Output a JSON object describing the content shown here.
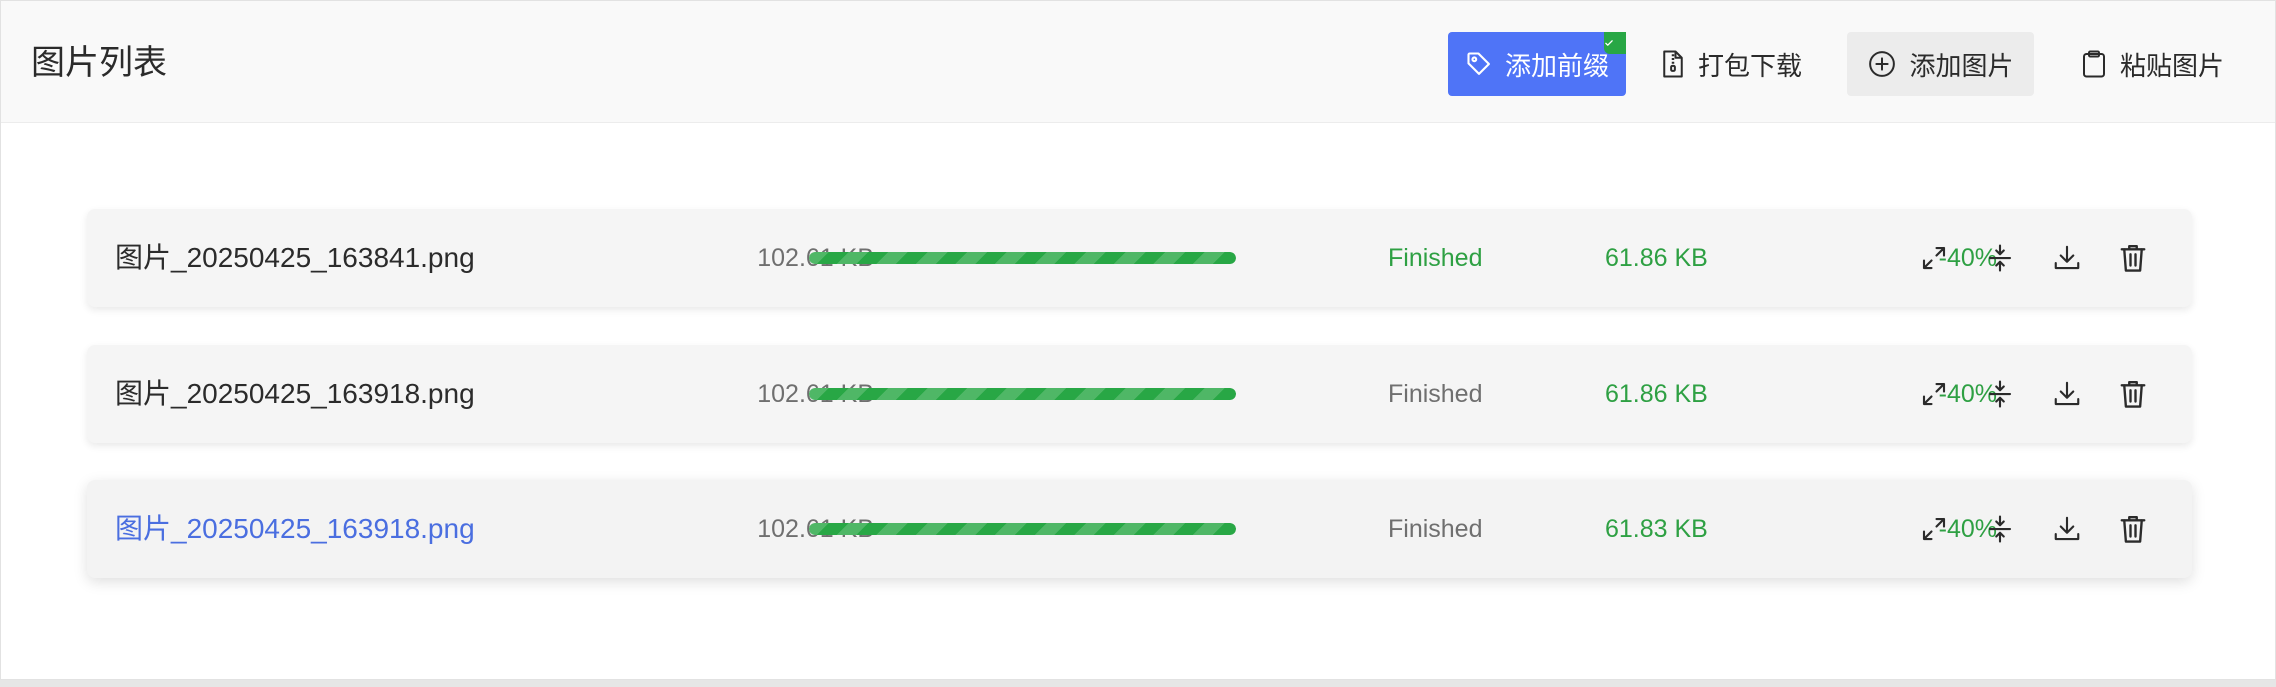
{
  "header": {
    "title": "图片列表",
    "buttons": {
      "add_prefix": "添加前缀",
      "pack_download": "打包下载",
      "add_image": "添加图片",
      "paste_image": "粘贴图片"
    }
  },
  "colors": {
    "accent": "#4f74f7",
    "success": "#2ea043",
    "active_link": "#4a6ee0",
    "muted_text": "#6f6f6f"
  },
  "files": [
    {
      "name": "图片_20250425_163841.png",
      "original_size": "102.61 KB",
      "progress_percent": 100,
      "status": "Finished",
      "compressed_size": "61.86 KB",
      "ratio": "-40%"
    },
    {
      "name": "图片_20250425_163918.png",
      "original_size": "102.61 KB",
      "progress_percent": 100,
      "status": "Finished",
      "compressed_size": "61.86 KB",
      "ratio": "-40%"
    },
    {
      "name": "图片_20250425_163918.png",
      "original_size": "102.61 KB",
      "progress_percent": 100,
      "status": "Finished",
      "compressed_size": "61.83 KB",
      "ratio": "-40%"
    }
  ],
  "icons": {
    "add_prefix": "tag-icon",
    "prefix_badge": "check-icon",
    "pack_download": "zip-file-icon",
    "add_image": "plus-circle-icon",
    "paste_image": "clipboard-icon",
    "row_actions": [
      "expand-icon",
      "compress-icon",
      "download-icon",
      "trash-icon"
    ]
  }
}
